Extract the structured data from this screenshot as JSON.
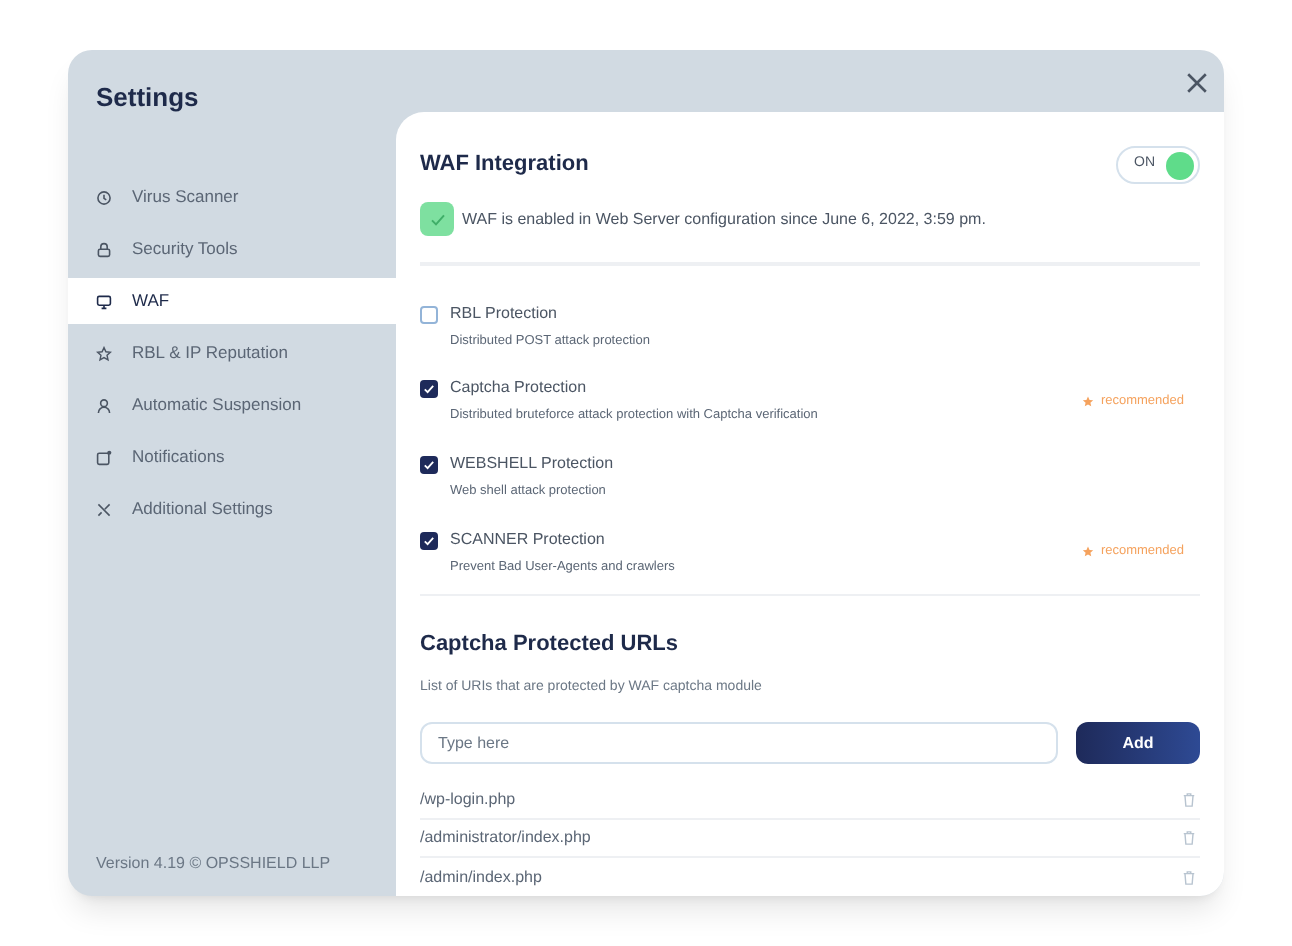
{
  "window": {
    "title": "Settings"
  },
  "sidebar": {
    "items": [
      {
        "label": "Virus Scanner",
        "selected": false
      },
      {
        "label": "Security Tools",
        "selected": false
      },
      {
        "label": "WAF",
        "selected": true
      },
      {
        "label": "RBL & IP Reputation",
        "selected": false
      },
      {
        "label": "Automatic Suspension",
        "selected": false
      },
      {
        "label": "Notifications",
        "selected": false
      },
      {
        "label": "Additional Settings",
        "selected": false
      }
    ],
    "footer": "Version 4.19 © OPSSHIELD LLP"
  },
  "waf": {
    "title": "WAF Integration",
    "toggle": {
      "label": "ON",
      "on": true
    },
    "notice": {
      "text": "WAF is enabled in Web Server configuration since June 6, 2022, 3:59 pm.",
      "checked": true
    },
    "protections": [
      {
        "title": "RBL Protection",
        "description": "Distributed POST attack protection",
        "checked": false
      },
      {
        "title": "Captcha Protection",
        "description": "Distributed bruteforce attack protection with Captcha verification",
        "checked": true,
        "badge": "recommended"
      },
      {
        "title": "WEBSHELL Protection",
        "description": "Web shell attack protection",
        "checked": true
      },
      {
        "title": "SCANNER Protection",
        "description": "Prevent Bad User-Agents and crawlers",
        "checked": true,
        "badge": "recommended"
      }
    ]
  },
  "captcha_urls": {
    "title": "Captcha Protected URLs",
    "description": "List of URIs that are protected by WAF captcha module",
    "input": {
      "placeholder": "Type here"
    },
    "add_button": "Add",
    "urls": [
      "/wp-login.php",
      "/administrator/index.php",
      "/admin/index.php"
    ]
  }
}
